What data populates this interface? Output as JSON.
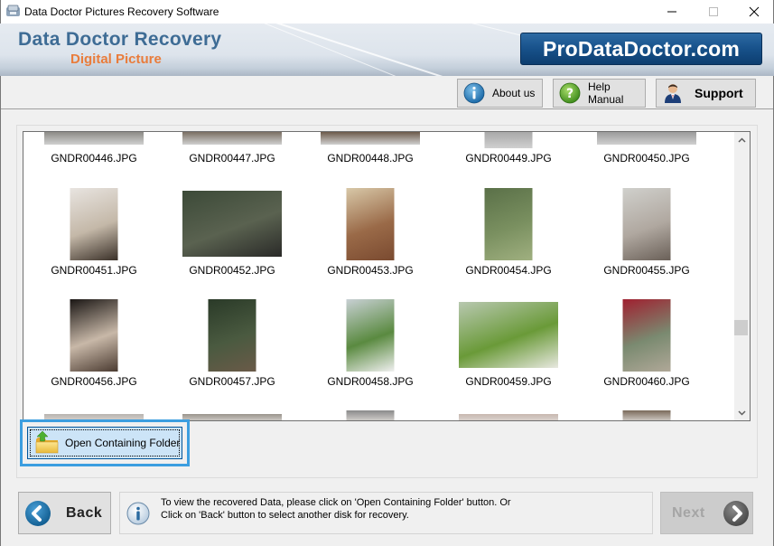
{
  "window": {
    "title": "Data Doctor Pictures Recovery Software",
    "controls": [
      "minimize",
      "maximize",
      "close"
    ]
  },
  "banner": {
    "brand_line1": "Data Doctor Recovery",
    "brand_line2": "Digital Picture",
    "site_badge": "ProDataDoctor.com",
    "colors": {
      "brand_blue": "#3e6c95",
      "brand_orange": "#e97c3b",
      "badge_blue": "#17518a"
    }
  },
  "toolbar": {
    "about_label": "About us",
    "help_label": "Help Manual",
    "support_label": "Support"
  },
  "gallery": {
    "partial_top": [
      {
        "name": "GNDR00446.JPG",
        "tone": "#8c8a86"
      },
      {
        "name": "GNDR00447.JPG",
        "tone": "#7a6f63"
      },
      {
        "name": "GNDR00448.JPG",
        "tone": "#6c5a4a"
      },
      {
        "name": "GNDR00449.JPG",
        "tone": "#a8a8a8"
      },
      {
        "name": "GNDR00450.JPG",
        "tone": "#9a9a9a"
      }
    ],
    "rows": [
      [
        {
          "name": "GNDR00451.JPG",
          "orientation": "portrait",
          "tones": [
            "#e8e4e0",
            "#c4b8a8",
            "#3a3028"
          ]
        },
        {
          "name": "GNDR00452.JPG",
          "orientation": "landscape",
          "tones": [
            "#3c4a38",
            "#5a6250",
            "#2a2a28"
          ]
        },
        {
          "name": "GNDR00453.JPG",
          "orientation": "portrait",
          "tones": [
            "#d8c8a8",
            "#9a6a48",
            "#7a4a30"
          ]
        },
        {
          "name": "GNDR00454.JPG",
          "orientation": "portrait",
          "tones": [
            "#5a7048",
            "#7a9060",
            "#a0b080"
          ]
        },
        {
          "name": "GNDR00455.JPG",
          "orientation": "portrait",
          "tones": [
            "#d0d0cc",
            "#b0a8a0",
            "#6a6058"
          ]
        }
      ],
      [
        {
          "name": "GNDR00456.JPG",
          "orientation": "portrait",
          "tones": [
            "#1a1614",
            "#c8b8a8",
            "#4a3a30"
          ]
        },
        {
          "name": "GNDR00457.JPG",
          "orientation": "portrait",
          "tones": [
            "#2a3a28",
            "#4a5a40",
            "#6a5a48"
          ]
        },
        {
          "name": "GNDR00458.JPG",
          "orientation": "portrait",
          "tones": [
            "#c8d0d4",
            "#5a8a40",
            "#f0f0f0"
          ]
        },
        {
          "name": "GNDR00459.JPG",
          "orientation": "landscape",
          "tones": [
            "#b8c8b0",
            "#6a9a38",
            "#e8e8e0"
          ]
        },
        {
          "name": "GNDR00460.JPG",
          "orientation": "portrait",
          "tones": [
            "#a02030",
            "#7a8a70",
            "#b0a898"
          ]
        }
      ]
    ],
    "partial_bottom": [
      {
        "tone": "#b8b4b0"
      },
      {
        "tone": "#9a948c"
      },
      {
        "tone": "#8a8a8a"
      },
      {
        "tone": "#c8b8b0"
      },
      {
        "tone": "#7a6a5a"
      }
    ],
    "scroll_position": 0.66
  },
  "actions": {
    "open_folder_label": "Open Containing Folder"
  },
  "footer": {
    "back_label": "Back",
    "info_line1": "To view the recovered Data, please click on 'Open Containing Folder' button. Or",
    "info_line2": "Click on 'Back' button to select another disk for recovery.",
    "next_label": "Next",
    "next_enabled": false
  }
}
